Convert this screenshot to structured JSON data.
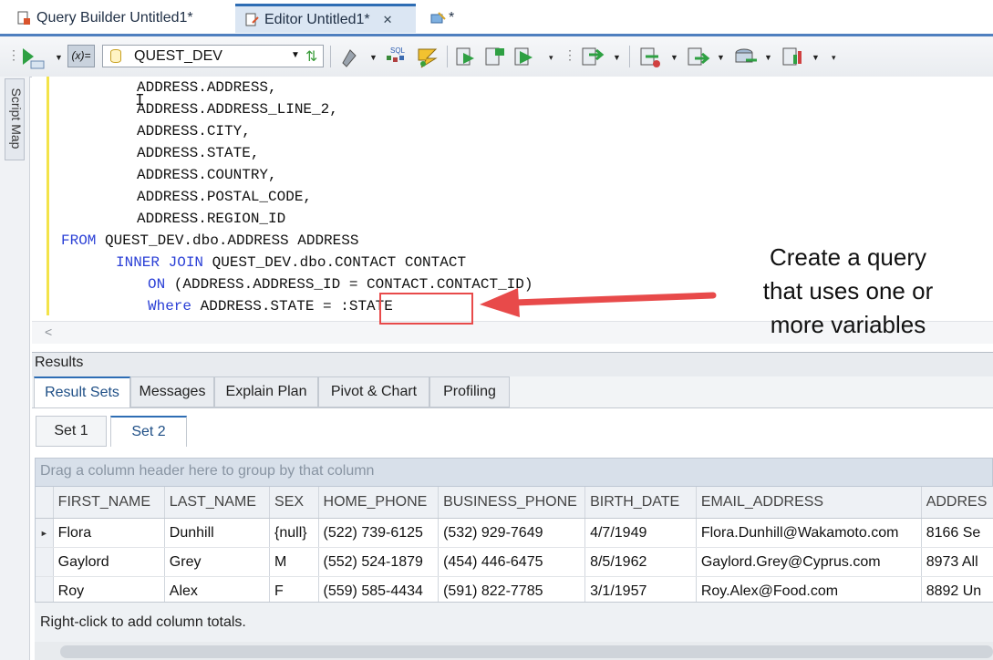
{
  "tabs": [
    {
      "label": "Query Builder Untitled1*",
      "icon": "query-builder-icon"
    },
    {
      "label": "Editor Untitled1*",
      "icon": "editor-icon",
      "close": "✕"
    },
    {
      "label": "*",
      "icon": "sql-new-icon"
    }
  ],
  "toolbar": {
    "variables_button": "(x)=",
    "connection": "QUEST_DEV"
  },
  "sidebar": {
    "script_map_label": "Script Map"
  },
  "editor": {
    "lines": [
      "ADDRESS.ADDRESS,",
      "ADDRESS.ADDRESS_LINE_2,",
      "ADDRESS.CITY,",
      "ADDRESS.STATE,",
      "ADDRESS.COUNTRY,",
      "ADDRESS.POSTAL_CODE,",
      "ADDRESS.REGION_ID"
    ],
    "from_kw": "FROM",
    "from_rest": " QUEST_DEV.dbo.ADDRESS ADDRESS",
    "join_kw": "INNER JOIN",
    "join_rest": " QUEST_DEV.dbo.CONTACT CONTACT",
    "on_kw": "ON",
    "on_rest": " (ADDRESS.ADDRESS_ID = CONTACT.CONTACT_ID)",
    "where_kw": "Where",
    "where_rest": " ADDRESS.STATE = ",
    "variable": ":STATE",
    "scroll_left": "<"
  },
  "annotation": {
    "line1": "Create a query",
    "line2": "that uses one or",
    "line3": "more variables"
  },
  "results": {
    "title": "Results",
    "tabs": [
      "Result Sets",
      "Messages",
      "Explain Plan",
      "Pivot & Chart",
      "Profiling"
    ],
    "sets": [
      "Set 1",
      "Set 2"
    ],
    "group_hint": "Drag a column header here to group by that column",
    "columns": [
      "FIRST_NAME",
      "LAST_NAME",
      "SEX",
      "HOME_PHONE",
      "BUSINESS_PHONE",
      "BIRTH_DATE",
      "EMAIL_ADDRESS",
      "ADDRES"
    ],
    "rows": [
      [
        "Flora",
        "Dunhill",
        "{null}",
        "(522) 739-6125",
        "(532) 929-7649",
        "4/7/1949",
        "Flora.Dunhill@Wakamoto.com",
        "8166 Se"
      ],
      [
        "Gaylord",
        "Grey",
        "M",
        "(552) 524-1879",
        "(454) 446-6475",
        "8/5/1962",
        "Gaylord.Grey@Cyprus.com",
        "8973 All"
      ],
      [
        "Roy",
        "Alex",
        "F",
        "(559) 585-4434",
        "(591) 822-7785",
        "3/1/1957",
        "Roy.Alex@Food.com",
        "8892 Un"
      ]
    ],
    "current_row_marker": "►",
    "footer": "Right-click to add column totals."
  },
  "colors": {
    "keyword": "#2a3fd6",
    "highlight": "#e84a4a",
    "accent": "#2e6db4"
  }
}
